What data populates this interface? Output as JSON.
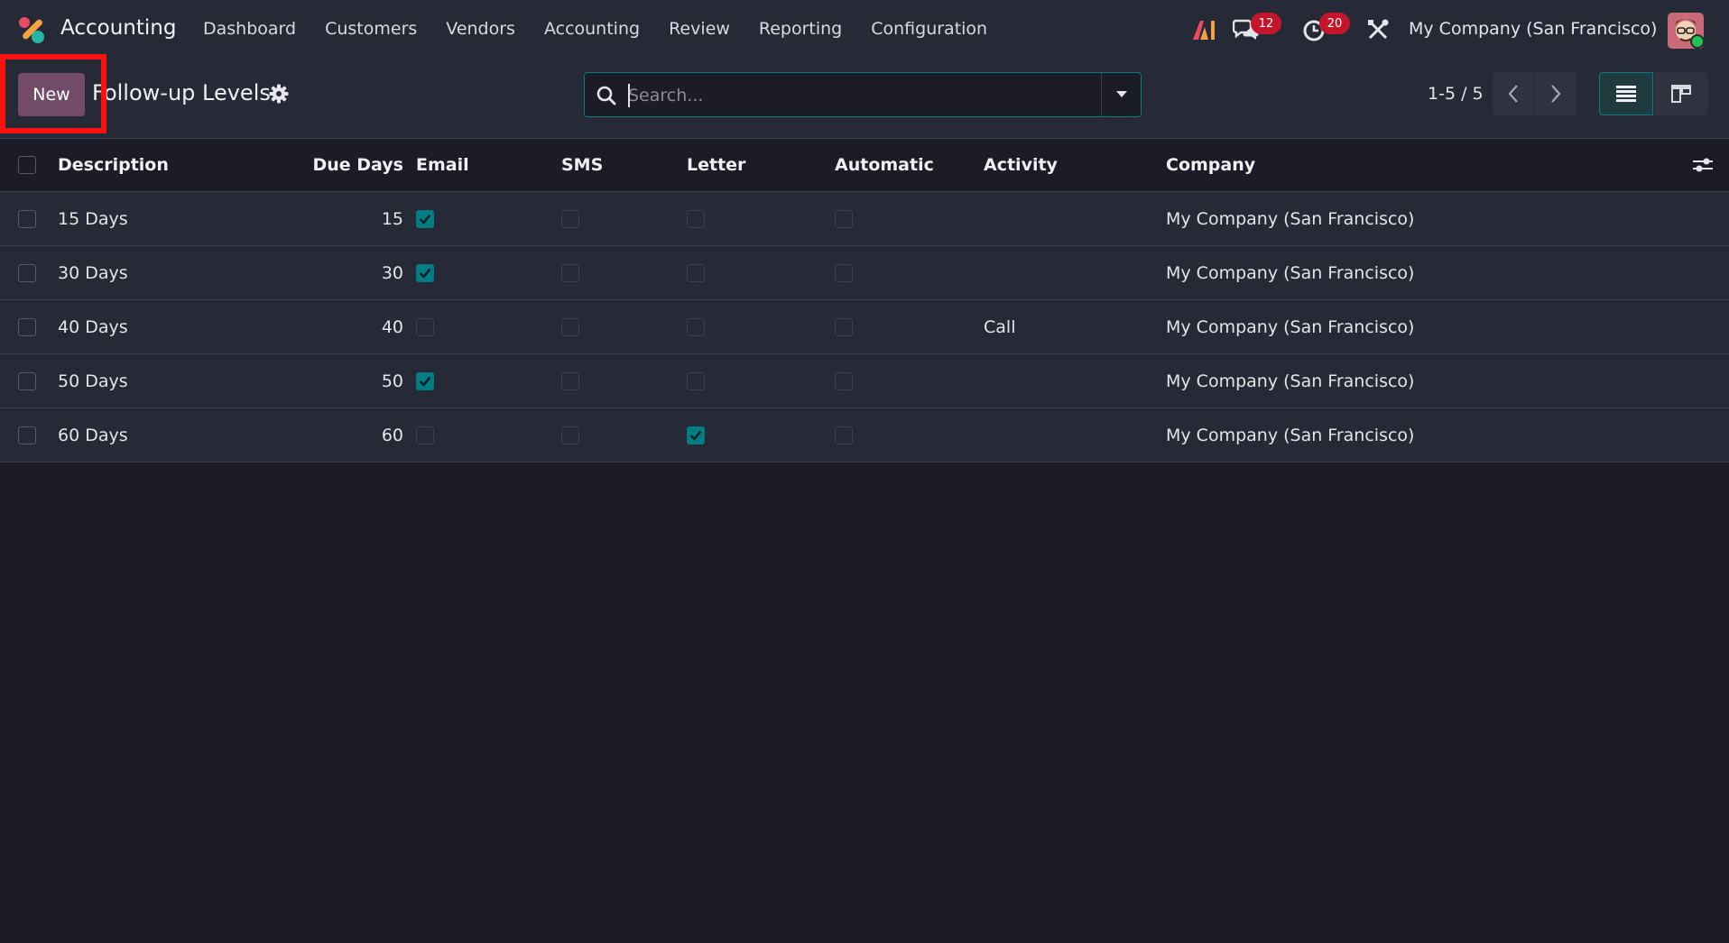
{
  "navbar": {
    "app_name": "Accounting",
    "menu": [
      "Dashboard",
      "Customers",
      "Vendors",
      "Accounting",
      "Review",
      "Reporting",
      "Configuration"
    ],
    "messages_count": "12",
    "activities_count": "20",
    "company": "My Company (San Francisco)"
  },
  "control_panel": {
    "new_label": "New",
    "title": "Follow-up Levels",
    "search_placeholder": "Search...",
    "pager": "1-5 / 5"
  },
  "table": {
    "headers": {
      "description": "Description",
      "due_days": "Due Days",
      "email": "Email",
      "sms": "SMS",
      "letter": "Letter",
      "automatic": "Automatic",
      "activity": "Activity",
      "company": "Company"
    },
    "rows": [
      {
        "description": "15 Days",
        "due_days": "15",
        "email": true,
        "sms": false,
        "letter": false,
        "automatic": false,
        "activity": "",
        "company": "My Company (San Francisco)"
      },
      {
        "description": "30 Days",
        "due_days": "30",
        "email": true,
        "sms": false,
        "letter": false,
        "automatic": false,
        "activity": "",
        "company": "My Company (San Francisco)"
      },
      {
        "description": "40 Days",
        "due_days": "40",
        "email": false,
        "sms": false,
        "letter": false,
        "automatic": false,
        "activity": "Call",
        "company": "My Company (San Francisco)"
      },
      {
        "description": "50 Days",
        "due_days": "50",
        "email": true,
        "sms": false,
        "letter": false,
        "automatic": false,
        "activity": "",
        "company": "My Company (San Francisco)"
      },
      {
        "description": "60 Days",
        "due_days": "60",
        "email": false,
        "sms": false,
        "letter": true,
        "automatic": false,
        "activity": "",
        "company": "My Company (San Francisco)"
      }
    ]
  },
  "colors": {
    "accent": "#017e84",
    "primary_button": "#714b67",
    "badge": "#c4162a",
    "highlight": "#ff1111",
    "background": "#1b1c26",
    "panel": "#262a36"
  },
  "icons": {
    "app_logo": "accounting-app-icon",
    "ai": "ai-icon",
    "messages": "chat-icon",
    "activities": "clock-icon",
    "debug": "tools-icon",
    "settings": "gear-icon",
    "search": "search-icon",
    "search_toggle": "caret-down-icon",
    "pager_prev": "chevron-left-icon",
    "pager_next": "chevron-right-icon",
    "list_view": "list-view-icon",
    "kanban_view": "kanban-view-icon",
    "optional_columns": "sliders-icon"
  }
}
